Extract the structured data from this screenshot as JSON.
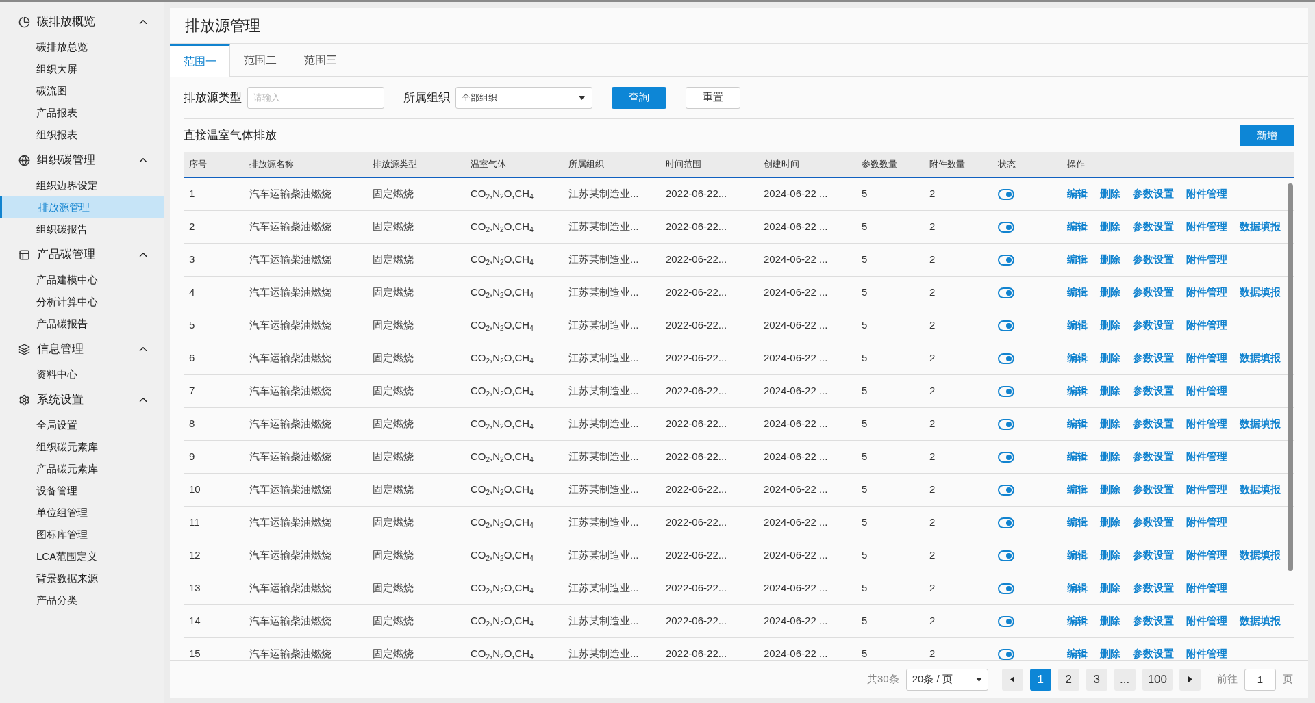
{
  "sidebar": {
    "groups": [
      {
        "title": "碳排放概览",
        "expanded": true,
        "items": [
          {
            "label": "碳排放总览",
            "selected": false
          },
          {
            "label": "组织大屏",
            "selected": false
          },
          {
            "label": "碳流图",
            "selected": false
          },
          {
            "label": "产品报表",
            "selected": false
          },
          {
            "label": "组织报表",
            "selected": false
          }
        ]
      },
      {
        "title": "组织碳管理",
        "expanded": true,
        "items": [
          {
            "label": "组织边界设定",
            "selected": false
          },
          {
            "label": "排放源管理",
            "selected": true
          },
          {
            "label": "组织碳报告",
            "selected": false
          }
        ]
      },
      {
        "title": "产品碳管理",
        "expanded": true,
        "items": [
          {
            "label": "产品建模中心",
            "selected": false
          },
          {
            "label": "分析计算中心",
            "selected": false
          },
          {
            "label": "产品碳报告",
            "selected": false
          }
        ]
      },
      {
        "title": "信息管理",
        "expanded": true,
        "items": [
          {
            "label": "资料中心",
            "selected": false
          }
        ]
      },
      {
        "title": "系统设置",
        "expanded": true,
        "items": [
          {
            "label": "全局设置",
            "selected": false
          },
          {
            "label": "组织碳元素库",
            "selected": false
          },
          {
            "label": "产品碳元素库",
            "selected": false
          },
          {
            "label": "设备管理",
            "selected": false
          },
          {
            "label": "单位组管理",
            "selected": false
          },
          {
            "label": "图标库管理",
            "selected": false
          },
          {
            "label": "LCA范围定义",
            "selected": false
          },
          {
            "label": "背景数据来源",
            "selected": false
          },
          {
            "label": "产品分类",
            "selected": false
          }
        ]
      }
    ]
  },
  "page_title": "排放源管理",
  "tabs": [
    {
      "label": "范围一",
      "selected": true
    },
    {
      "label": "范围二",
      "selected": false
    },
    {
      "label": "范围三",
      "selected": false
    }
  ],
  "filters": {
    "type_label": "排放源类型",
    "type_placeholder": "请输入",
    "org_label": "所属组织",
    "org_value": "全部组织",
    "query_button": "查詢",
    "reset_button": "重置"
  },
  "section_title": "直接温室气体排放",
  "add_button": "新增",
  "table": {
    "columns": [
      "序号",
      "排放源名称",
      "排放源类型",
      "温室气体",
      "所属组织",
      "时间范围",
      "创建时间",
      "参数数量",
      "附件数量",
      "状态",
      "操作"
    ],
    "rows": [
      {
        "no": "1",
        "name": "汽车运输柴油燃烧",
        "type": "固定燃烧",
        "gas": "CO$_{2}$,N$_{2}$O,CH$_{4}$",
        "org": "江苏某制造业...",
        "time_range": "2022-06-22...",
        "created": "2024-06-22 ...",
        "params": "5",
        "attachments": "2",
        "on": true,
        "actions": [
          "编辑",
          "删除",
          "参数设置",
          "附件管理"
        ]
      },
      {
        "no": "2",
        "name": "汽车运输柴油燃烧",
        "type": "固定燃烧",
        "gas": "CO$_{2}$,N$_{2}$O,CH$_{4}$",
        "org": "江苏某制造业...",
        "time_range": "2022-06-22...",
        "created": "2024-06-22 ...",
        "params": "5",
        "attachments": "2",
        "on": true,
        "actions": [
          "编辑",
          "删除",
          "参数设置",
          "附件管理",
          "数据填报"
        ]
      },
      {
        "no": "3",
        "name": "汽车运输柴油燃烧",
        "type": "固定燃烧",
        "gas": "CO$_{2}$,N$_{2}$O,CH$_{4}$",
        "org": "江苏某制造业...",
        "time_range": "2022-06-22...",
        "created": "2024-06-22 ...",
        "params": "5",
        "attachments": "2",
        "on": true,
        "actions": [
          "编辑",
          "删除",
          "参数设置",
          "附件管理"
        ]
      },
      {
        "no": "4",
        "name": "汽车运输柴油燃烧",
        "type": "固定燃烧",
        "gas": "CO$_{2}$,N$_{2}$O,CH$_{4}$",
        "org": "江苏某制造业...",
        "time_range": "2022-06-22...",
        "created": "2024-06-22 ...",
        "params": "5",
        "attachments": "2",
        "on": true,
        "actions": [
          "编辑",
          "删除",
          "参数设置",
          "附件管理",
          "数据填报"
        ]
      },
      {
        "no": "5",
        "name": "汽车运输柴油燃烧",
        "type": "固定燃烧",
        "gas": "CO$_{2}$,N$_{2}$O,CH$_{4}$",
        "org": "江苏某制造业...",
        "time_range": "2022-06-22...",
        "created": "2024-06-22 ...",
        "params": "5",
        "attachments": "2",
        "on": true,
        "actions": [
          "编辑",
          "删除",
          "参数设置",
          "附件管理"
        ]
      },
      {
        "no": "6",
        "name": "汽车运输柴油燃烧",
        "type": "固定燃烧",
        "gas": "CO$_{2}$,N$_{2}$O,CH$_{4}$",
        "org": "江苏某制造业...",
        "time_range": "2022-06-22...",
        "created": "2024-06-22 ...",
        "params": "5",
        "attachments": "2",
        "on": true,
        "actions": [
          "编辑",
          "删除",
          "参数设置",
          "附件管理",
          "数据填报"
        ]
      },
      {
        "no": "7",
        "name": "汽车运输柴油燃烧",
        "type": "固定燃烧",
        "gas": "CO$_{2}$,N$_{2}$O,CH$_{4}$",
        "org": "江苏某制造业...",
        "time_range": "2022-06-22...",
        "created": "2024-06-22 ...",
        "params": "5",
        "attachments": "2",
        "on": true,
        "actions": [
          "编辑",
          "删除",
          "参数设置",
          "附件管理"
        ]
      },
      {
        "no": "8",
        "name": "汽车运输柴油燃烧",
        "type": "固定燃烧",
        "gas": "CO$_{2}$,N$_{2}$O,CH$_{4}$",
        "org": "江苏某制造业...",
        "time_range": "2022-06-22...",
        "created": "2024-06-22 ...",
        "params": "5",
        "attachments": "2",
        "on": true,
        "actions": [
          "编辑",
          "删除",
          "参数设置",
          "附件管理",
          "数据填报"
        ]
      },
      {
        "no": "9",
        "name": "汽车运输柴油燃烧",
        "type": "固定燃烧",
        "gas": "CO$_{2}$,N$_{2}$O,CH$_{4}$",
        "org": "江苏某制造业...",
        "time_range": "2022-06-22...",
        "created": "2024-06-22 ...",
        "params": "5",
        "attachments": "2",
        "on": true,
        "actions": [
          "编辑",
          "删除",
          "参数设置",
          "附件管理"
        ]
      },
      {
        "no": "10",
        "name": "汽车运输柴油燃烧",
        "type": "固定燃烧",
        "gas": "CO$_{2}$,N$_{2}$O,CH$_{4}$",
        "org": "江苏某制造业...",
        "time_range": "2022-06-22...",
        "created": "2024-06-22 ...",
        "params": "5",
        "attachments": "2",
        "on": true,
        "actions": [
          "编辑",
          "删除",
          "参数设置",
          "附件管理",
          "数据填报"
        ]
      },
      {
        "no": "11",
        "name": "汽车运输柴油燃烧",
        "type": "固定燃烧",
        "gas": "CO$_{2}$,N$_{2}$O,CH$_{4}$",
        "org": "江苏某制造业...",
        "time_range": "2022-06-22...",
        "created": "2024-06-22 ...",
        "params": "5",
        "attachments": "2",
        "on": true,
        "actions": [
          "编辑",
          "删除",
          "参数设置",
          "附件管理"
        ]
      },
      {
        "no": "12",
        "name": "汽车运输柴油燃烧",
        "type": "固定燃烧",
        "gas": "CO$_{2}$,N$_{2}$O,CH$_{4}$",
        "org": "江苏某制造业...",
        "time_range": "2022-06-22...",
        "created": "2024-06-22 ...",
        "params": "5",
        "attachments": "2",
        "on": true,
        "actions": [
          "编辑",
          "删除",
          "参数设置",
          "附件管理",
          "数据填报"
        ]
      },
      {
        "no": "13",
        "name": "汽车运输柴油燃烧",
        "type": "固定燃烧",
        "gas": "CO$_{2}$,N$_{2}$O,CH$_{4}$",
        "org": "江苏某制造业...",
        "time_range": "2022-06-22...",
        "created": "2024-06-22 ...",
        "params": "5",
        "attachments": "2",
        "on": true,
        "actions": [
          "编辑",
          "删除",
          "参数设置",
          "附件管理"
        ]
      },
      {
        "no": "14",
        "name": "汽车运输柴油燃烧",
        "type": "固定燃烧",
        "gas": "CO$_{2}$,N$_{2}$O,CH$_{4}$",
        "org": "江苏某制造业...",
        "time_range": "2022-06-22...",
        "created": "2024-06-22 ...",
        "params": "5",
        "attachments": "2",
        "on": true,
        "actions": [
          "编辑",
          "删除",
          "参数设置",
          "附件管理",
          "数据填报"
        ]
      },
      {
        "no": "15",
        "name": "汽车运输柴油燃烧",
        "type": "固定燃烧",
        "gas": "CO$_{2}$,N$_{2}$O,CH$_{4}$",
        "org": "江苏某制造业...",
        "time_range": "2022-06-22...",
        "created": "2024-06-22 ...",
        "params": "5",
        "attachments": "2",
        "on": true,
        "actions": [
          "编辑",
          "删除",
          "参数设置",
          "附件管理"
        ]
      }
    ]
  },
  "pagination": {
    "total": "共30条",
    "page_size": "20条 / 页",
    "pages": [
      {
        "label": "1",
        "selected": true
      },
      {
        "label": "2",
        "selected": false
      },
      {
        "label": "3",
        "selected": false
      },
      {
        "label": "...",
        "selected": false
      },
      {
        "label": "100",
        "selected": false
      }
    ],
    "goto_label": "前往",
    "goto_value": "1",
    "page_unit": "页"
  }
}
